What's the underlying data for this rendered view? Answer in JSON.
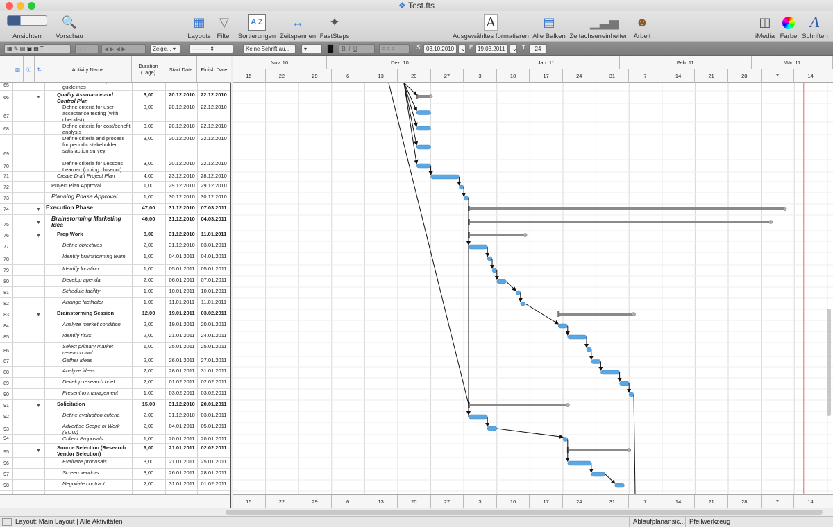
{
  "window": {
    "title": "Test.fts"
  },
  "toolbar": {
    "views": "Ansichten",
    "preview": "Vorschau",
    "layouts": "Layouts",
    "filter": "Filter",
    "sortings": "Sortierungen",
    "timespans": "Zeitspannen",
    "faststeps": "FastSteps",
    "format_selected": "Ausgewähltes formatieren",
    "all_bars": "Alle Balken",
    "time_units": "Zeitachseneinheiten",
    "work": "Arbeit",
    "imedia": "iMedia",
    "color": "Farbe",
    "fonts": "Schriften"
  },
  "formatbar": {
    "show": "Zeige...",
    "font": "Keine Schrift au...",
    "start_prefix": "S",
    "start_date": "03.10.2010",
    "end_prefix": "E",
    "end_date": "19.03.2011",
    "t_prefix": "T",
    "t_value": "24",
    "bold": "B",
    "italic": "I",
    "underline": "U"
  },
  "colors": {
    "bar": "#5aa7e4",
    "summary": "#8a8a8a",
    "today_line": "#e26a6a",
    "link": "#111111"
  },
  "table": {
    "headers": {
      "name": "Activity Name",
      "duration": "Duration (Tage)",
      "start": "Start Date",
      "finish": "Finish Date"
    },
    "rows": [
      {
        "num": "65",
        "name": "executive status report guidelines",
        "dur": "",
        "start": "",
        "finish": "",
        "h": 20,
        "indent": 3
      },
      {
        "num": "66",
        "name": "Quality Assurance and Control Plan",
        "dur": "3,00",
        "start": "20.12.2010",
        "finish": "22.12.2010",
        "h": 18,
        "indent": 2,
        "bold": true,
        "italic": true,
        "tri": true
      },
      {
        "num": "67",
        "name": "Define criteria for user-acceptance testing (with checklist)",
        "dur": "3,00",
        "start": "20.12.2010",
        "finish": "22.12.2010",
        "h": 27,
        "indent": 3
      },
      {
        "num": "68",
        "name": "Define criteria for cost/benefit analysis",
        "dur": "3,00",
        "start": "20.12.2010",
        "finish": "22.12.2010",
        "h": 18,
        "indent": 3
      },
      {
        "num": "69",
        "name": "Define criteria and process for periodic stakeholder satisfaction survey",
        "dur": "3,00",
        "start": "20.12.2010",
        "finish": "22.12.2010",
        "h": 36,
        "indent": 3
      },
      {
        "num": "70",
        "name": "Define criteria for Lessons Learned (during closeout)",
        "dur": "3,00",
        "start": "20.12.2010",
        "finish": "22.12.2010",
        "h": 18,
        "indent": 3
      },
      {
        "num": "71",
        "name": "Create Draft Project Plan",
        "dur": "4,00",
        "start": "23.12.2010",
        "finish": "28.12.2010",
        "h": 14,
        "indent": 2,
        "italic": true
      },
      {
        "num": "72",
        "name": "Project Plan Approval",
        "dur": "1,00",
        "start": "29.12.2010",
        "finish": "29.12.2010",
        "h": 16,
        "indent": 1
      },
      {
        "num": "73",
        "name": "Planning Phase Approval",
        "dur": "1,00",
        "start": "30.12.2010",
        "finish": "30.12.2010",
        "h": 16,
        "indent": 1,
        "italic": true,
        "big": true
      },
      {
        "num": "74",
        "name": "Execution Phase",
        "dur": "47,00",
        "start": "31.12.2010",
        "finish": "07.03.2011",
        "h": 16,
        "indent": 0,
        "bold": true,
        "big": true,
        "tri": true
      },
      {
        "num": "75",
        "name": "Brainstorming Marketing Idea",
        "dur": "46,00",
        "start": "31.12.2010",
        "finish": "04.03.2011",
        "h": 22,
        "indent": 1,
        "bold": true,
        "italic": true,
        "big": true,
        "tri": true
      },
      {
        "num": "76",
        "name": "Prep Work",
        "dur": "8,00",
        "start": "31.12.2010",
        "finish": "11.01.2011",
        "h": 16,
        "indent": 2,
        "bold": true,
        "tri": true
      },
      {
        "num": "77",
        "name": "Define objectives",
        "dur": "2,00",
        "start": "31.12.2010",
        "finish": "03.01.2011",
        "h": 16,
        "indent": 3,
        "italic": true
      },
      {
        "num": "78",
        "name": "Identify brainstorming team",
        "dur": "1,00",
        "start": "04.01.2011",
        "finish": "04.01.2011",
        "h": 18,
        "indent": 3,
        "italic": true
      },
      {
        "num": "79",
        "name": "Identify location",
        "dur": "1,00",
        "start": "05.01.2011",
        "finish": "05.01.2011",
        "h": 16,
        "indent": 3,
        "italic": true
      },
      {
        "num": "80",
        "name": "Develop agenda",
        "dur": "2,00",
        "start": "06.01.2011",
        "finish": "07.01.2011",
        "h": 16,
        "indent": 3,
        "italic": true
      },
      {
        "num": "81",
        "name": "Schedule facility",
        "dur": "1,00",
        "start": "10.01.2011",
        "finish": "10.01.2011",
        "h": 16,
        "indent": 3,
        "italic": true
      },
      {
        "num": "82",
        "name": "Arrange facilitator",
        "dur": "1,00",
        "start": "11.01.2011",
        "finish": "11.01.2011",
        "h": 16,
        "indent": 3,
        "italic": true
      },
      {
        "num": "83",
        "name": "Brainstorming Session",
        "dur": "12,00",
        "start": "19.01.2011",
        "finish": "03.02.2011",
        "h": 16,
        "indent": 2,
        "bold": true,
        "tri": true
      },
      {
        "num": "84",
        "name": "Analyze market condition",
        "dur": "2,00",
        "start": "19.01.2011",
        "finish": "20.01.2011",
        "h": 16,
        "indent": 3,
        "italic": true
      },
      {
        "num": "85",
        "name": "Identify risks",
        "dur": "2,00",
        "start": "21.01.2011",
        "finish": "24.01.2011",
        "h": 16,
        "indent": 3,
        "italic": true
      },
      {
        "num": "86",
        "name": "Select primary market research tool",
        "dur": "1,00",
        "start": "25.01.2011",
        "finish": "25.01.2011",
        "h": 20,
        "indent": 3,
        "italic": true
      },
      {
        "num": "87",
        "name": "Gather ideas",
        "dur": "2,00",
        "start": "26.01.2011",
        "finish": "27.01.2011",
        "h": 15,
        "indent": 3,
        "italic": true
      },
      {
        "num": "88",
        "name": "Analyze ideas",
        "dur": "2,00",
        "start": "28.01.2011",
        "finish": "31.01.2011",
        "h": 16,
        "indent": 3,
        "italic": true
      },
      {
        "num": "89",
        "name": "Develop research brief",
        "dur": "2,00",
        "start": "01.02.2011",
        "finish": "02.02.2011",
        "h": 16,
        "indent": 3,
        "italic": true
      },
      {
        "num": "90",
        "name": "Present to management",
        "dur": "1,00",
        "start": "03.02.2011",
        "finish": "03.02.2011",
        "h": 16,
        "indent": 3,
        "italic": true
      },
      {
        "num": "91",
        "name": "Solicitation",
        "dur": "15,00",
        "start": "31.12.2010",
        "finish": "20.01.2011",
        "h": 16,
        "indent": 2,
        "bold": true,
        "tri": true
      },
      {
        "num": "92",
        "name": "Define evaluation criteria",
        "dur": "2,00",
        "start": "31.12.2010",
        "finish": "03.01.2011",
        "h": 16,
        "indent": 3,
        "italic": true
      },
      {
        "num": "93",
        "name": "Advertise Scope of Work (SOW)",
        "dur": "2,00",
        "start": "04.01.2011",
        "finish": "05.01.2011",
        "h": 18,
        "indent": 3,
        "italic": true
      },
      {
        "num": "94",
        "name": "Collect Proposals",
        "dur": "1,00",
        "start": "20.01.2011",
        "finish": "20.01.2011",
        "h": 13,
        "indent": 3,
        "italic": true
      },
      {
        "num": "95",
        "name": "Source Selection (Research Vendor Selection)",
        "dur": "9,00",
        "start": "21.01.2011",
        "finish": "02.02.2011",
        "h": 20,
        "indent": 2,
        "bold": true,
        "tri": true
      },
      {
        "num": "96",
        "name": "Evaluate proposals",
        "dur": "3,00",
        "start": "21.01.2011",
        "finish": "25.01.2011",
        "h": 16,
        "indent": 3,
        "italic": true
      },
      {
        "num": "97",
        "name": "Screen vendors",
        "dur": "3,00",
        "start": "26.01.2011",
        "finish": "28.01.2011",
        "h": 16,
        "indent": 3,
        "italic": true
      },
      {
        "num": "98",
        "name": "Negotiate contract",
        "dur": "2,00",
        "start": "31.01.2011",
        "finish": "01.02.2011",
        "h": 16,
        "indent": 3,
        "italic": true
      }
    ]
  },
  "timeline": {
    "months": [
      {
        "label": "Nov. 10"
      },
      {
        "label": "Dez. 10"
      },
      {
        "label": "Jan. 11"
      },
      {
        "label": "Feb. 11"
      },
      {
        "label": "Mär. 11"
      }
    ],
    "days": [
      "15",
      "22",
      "29",
      "6",
      "13",
      "20",
      "27",
      "3",
      "10",
      "17",
      "24",
      "31",
      "7",
      "14",
      "21",
      "28",
      "7",
      "14"
    ]
  },
  "statusbar": {
    "layout": "Layout: Main Layout | Alle Aktivitäten",
    "view": "Ablaufplanansic...",
    "tool": "Pfeilwerkzeug"
  }
}
